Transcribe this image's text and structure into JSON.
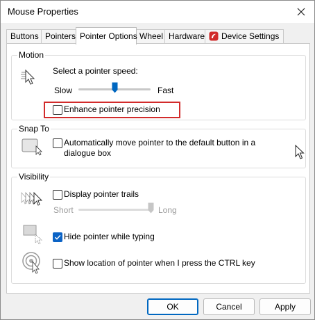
{
  "window": {
    "title": "Mouse Properties"
  },
  "tabs": [
    {
      "label": "Buttons"
    },
    {
      "label": "Pointers"
    },
    {
      "label": "Pointer Options",
      "active": true
    },
    {
      "label": "Wheel"
    },
    {
      "label": "Hardware"
    },
    {
      "label": "Device Settings"
    }
  ],
  "motion": {
    "title": "Motion",
    "speed_label": "Select a pointer speed:",
    "slow": "Slow",
    "fast": "Fast",
    "speed_level": 0.5,
    "precision": {
      "label": "Enhance pointer precision",
      "checked": false
    }
  },
  "snap": {
    "title": "Snap To",
    "option": {
      "label_line1": "Automatically move pointer to the default button in a",
      "label_line2": "dialogue box",
      "checked": false
    }
  },
  "visibility": {
    "title": "Visibility",
    "trails": {
      "label": "Display pointer trails",
      "checked": false
    },
    "short": "Short",
    "long": "Long",
    "trail_level": 1.0,
    "hide": {
      "label": "Hide pointer while typing",
      "checked": true
    },
    "ctrl": {
      "label": "Show location of pointer when I press the CTRL key",
      "checked": false
    }
  },
  "buttons": {
    "ok": "OK",
    "cancel": "Cancel",
    "apply": "Apply"
  },
  "colors": {
    "accent": "#0067c0",
    "highlight": "#d22b2b",
    "device_icon": "#d12b2b"
  }
}
